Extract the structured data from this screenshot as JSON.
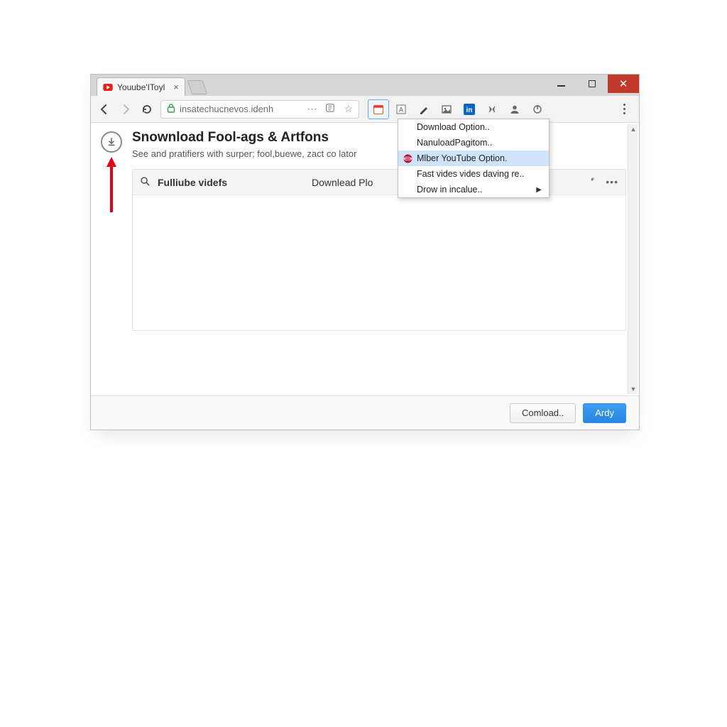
{
  "window": {
    "tab_title": "Youube'IToyl"
  },
  "addressbar": {
    "url": "insatechucnevos.idenh"
  },
  "extension_icons": [
    "calendar-icon",
    "note-a-icon",
    "pen-icon",
    "picture-icon",
    "linkedin-icon",
    "broadcast-icon",
    "person-icon",
    "power-icon"
  ],
  "dropdown": {
    "items": [
      {
        "label": "Download Option..",
        "icon": ""
      },
      {
        "label": "NanuloadPagitom..",
        "icon": ""
      },
      {
        "label": "Mlber YouTube Option.",
        "icon": "sphere",
        "highlight": true
      },
      {
        "label": "Fast vides vides daving re..",
        "icon": ""
      },
      {
        "label": "Drow in incalue..",
        "icon": "",
        "submenu": true
      }
    ]
  },
  "page": {
    "title": "Snownload Fool-ags & Artfons",
    "subtitle": "See and pratifiers with surper; fool,buewe, zact co lator"
  },
  "listheader": {
    "col1": "Fulliube videfs",
    "col2": "Downlead Plo"
  },
  "footer": {
    "cancel": "Comload..",
    "primary": "Ardy"
  }
}
